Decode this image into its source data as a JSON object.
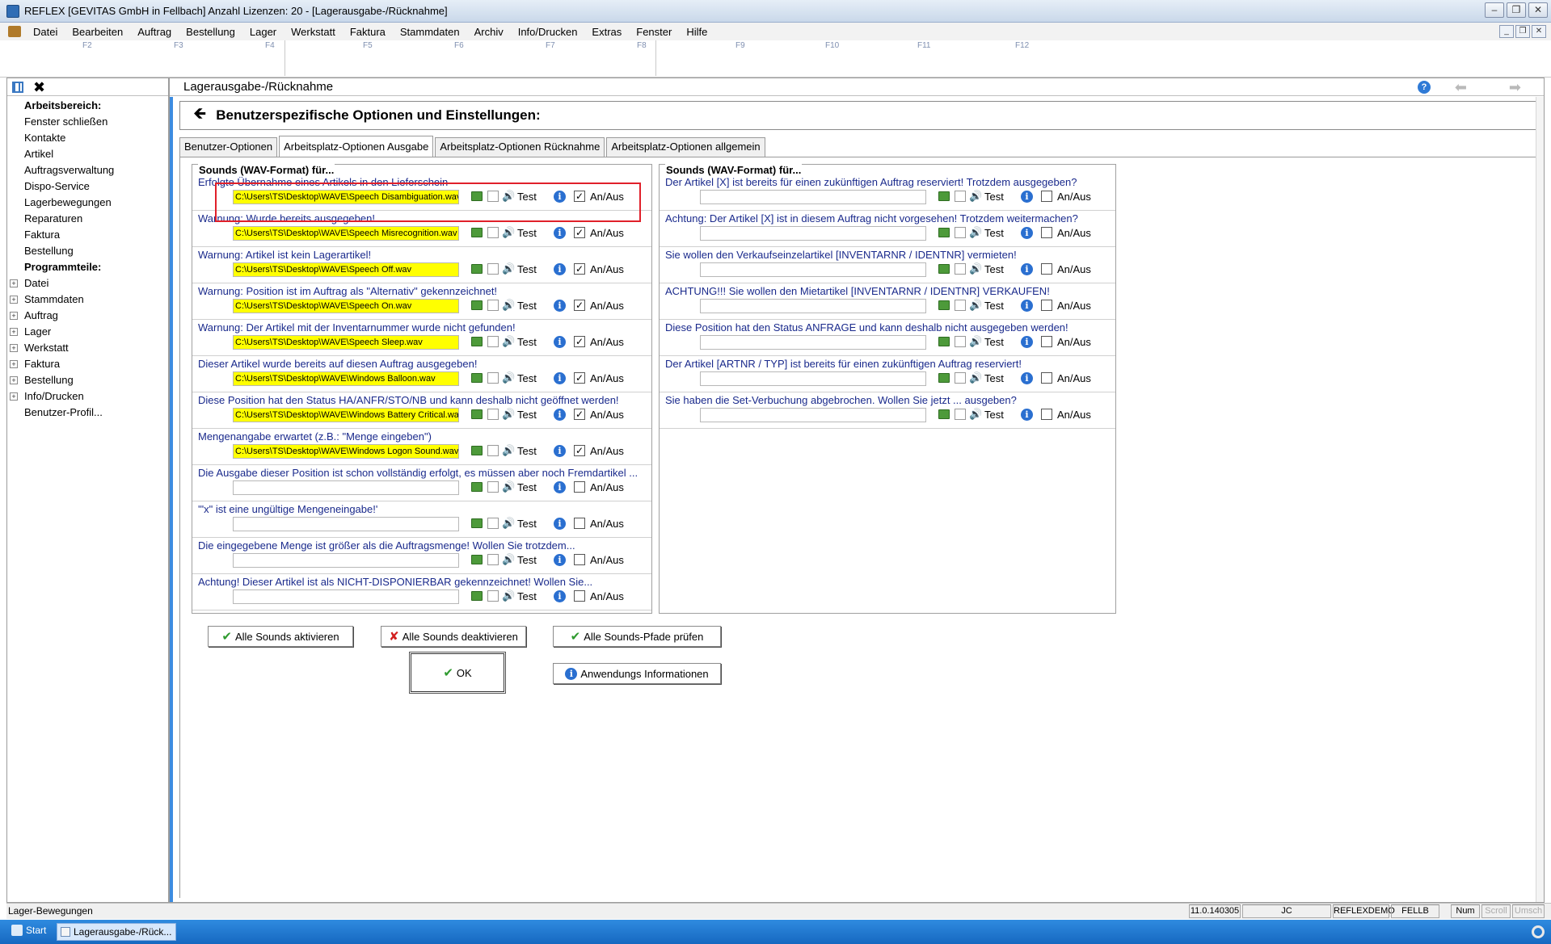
{
  "window": {
    "title": "REFLEX [GEVITAS GmbH in Fellbach] Anzahl Lizenzen: 20 - [Lagerausgabe-/Rücknahme]",
    "controls": {
      "minimize": "–",
      "restore": "❐",
      "close": "✕"
    }
  },
  "menubar": {
    "items": [
      "Datei",
      "Bearbeiten",
      "Auftrag",
      "Bestellung",
      "Lager",
      "Werkstatt",
      "Faktura",
      "Stammdaten",
      "Archiv",
      "Info/Drucken",
      "Extras",
      "Fenster",
      "Hilfe"
    ],
    "mdi_controls": {
      "minimize": "_",
      "restore": "❐",
      "close": "✕"
    }
  },
  "fkeys": [
    "F2",
    "F3",
    "F4",
    "F5",
    "F6",
    "F7",
    "F8",
    "F9",
    "F10",
    "F11",
    "F12"
  ],
  "sidebar": {
    "items": [
      {
        "label": "Arbeitsbereich:",
        "head": true
      },
      {
        "label": "Fenster schließen"
      },
      {
        "label": "Kontakte"
      },
      {
        "label": "Artikel"
      },
      {
        "label": "Auftragsverwaltung"
      },
      {
        "label": "Dispo-Service"
      },
      {
        "label": "Lagerbewegungen"
      },
      {
        "label": "Reparaturen"
      },
      {
        "label": "Faktura"
      },
      {
        "label": "Bestellung"
      },
      {
        "label": "Programmteile:",
        "head": true
      },
      {
        "label": "Datei",
        "expand": true
      },
      {
        "label": "Stammdaten",
        "expand": true
      },
      {
        "label": "Auftrag",
        "expand": true
      },
      {
        "label": "Lager",
        "expand": true
      },
      {
        "label": "Werkstatt",
        "expand": true
      },
      {
        "label": "Faktura",
        "expand": true
      },
      {
        "label": "Bestellung",
        "expand": true
      },
      {
        "label": "Info/Drucken",
        "expand": true
      },
      {
        "label": "Benutzer-Profil..."
      }
    ]
  },
  "main": {
    "title": "Lagerausgabe-/Rücknahme",
    "options_title": "Benutzerspezifische Optionen und Einstellungen:",
    "tabs": [
      {
        "label": "Benutzer-Optionen",
        "active": false
      },
      {
        "label": "Arbeitsplatz-Optionen Ausgabe",
        "active": true
      },
      {
        "label": "Arbeitsplatz-Optionen Rücknahme",
        "active": false
      },
      {
        "label": "Arbeitsplatz-Optionen allgemein",
        "active": false
      }
    ],
    "left_group": {
      "title": "Sounds (WAV-Format) für...",
      "rows": [
        {
          "label": "Erfolgte Übernahme eines Artikels in den Lieferschein",
          "path": "C:\\Users\\TS\\Desktop\\WAVE\\Speech Disambiguation.wav",
          "enabled": true
        },
        {
          "label": "Warnung: Wurde bereits ausgegeben!",
          "path": "C:\\Users\\TS\\Desktop\\WAVE\\Speech Misrecognition.wav",
          "enabled": true
        },
        {
          "label": "Warnung: Artikel ist kein Lagerartikel!",
          "path": "C:\\Users\\TS\\Desktop\\WAVE\\Speech Off.wav",
          "enabled": true
        },
        {
          "label": "Warnung: Position ist im Auftrag als \"Alternativ\" gekennzeichnet!",
          "path": "C:\\Users\\TS\\Desktop\\WAVE\\Speech On.wav",
          "enabled": true
        },
        {
          "label": "Warnung: Der Artikel mit der Inventarnummer wurde nicht gefunden!",
          "path": "C:\\Users\\TS\\Desktop\\WAVE\\Speech Sleep.wav",
          "enabled": true
        },
        {
          "label": "Dieser Artikel wurde bereits auf diesen Auftrag ausgegeben!",
          "path": "C:\\Users\\TS\\Desktop\\WAVE\\Windows Balloon.wav",
          "enabled": true
        },
        {
          "label": " Diese Position hat den Status HA/ANFR/STO/NB und kann deshalb nicht geöffnet werden!",
          "path": "C:\\Users\\TS\\Desktop\\WAVE\\Windows Battery Critical.wa",
          "enabled": true
        },
        {
          "label": "Mengenangabe erwartet (z.B.: \"Menge eingeben\")",
          "path": "C:\\Users\\TS\\Desktop\\WAVE\\Windows Logon Sound.wav",
          "enabled": true
        },
        {
          "label": "Die Ausgabe dieser Position ist schon vollständig erfolgt, es müssen aber noch Fremdartikel ...",
          "path": "",
          "enabled": false
        },
        {
          "label": "'\"x\" ist eine ungültige Mengeneingabe!'",
          "path": "",
          "enabled": false
        },
        {
          "label": "Die eingegebene Menge ist größer als die Auftragsmenge! Wollen Sie trotzdem...",
          "path": "",
          "enabled": false
        },
        {
          "label": "Achtung! Dieser Artikel ist als NICHT-DISPONIERBAR gekennzeichnet! Wollen Sie...",
          "path": "",
          "enabled": false
        }
      ]
    },
    "right_group": {
      "title": "Sounds (WAV-Format) für...",
      "rows": [
        {
          "label": "Der Artikel [X] ist bereits für einen zukünftigen Auftrag reserviert! Trotzdem ausgegeben?",
          "path": "",
          "enabled": false
        },
        {
          "label": "Achtung: Der Artikel [X] ist in diesem Auftrag nicht vorgesehen! Trotzdem weitermachen?",
          "path": "",
          "enabled": false
        },
        {
          "label": "Sie wollen den Verkaufseinzelartikel [INVENTARNR / IDENTNR] vermieten!",
          "path": "",
          "enabled": false
        },
        {
          "label": "ACHTUNG!!! Sie wollen den Mietartikel [INVENTARNR / IDENTNR] VERKAUFEN!",
          "path": "",
          "enabled": false
        },
        {
          "label": "Diese Position hat den Status ANFRAGE und kann deshalb nicht ausgegeben werden!",
          "path": "",
          "enabled": false
        },
        {
          "label": "Der Artikel [ARTNR / TYP] ist bereits für einen zukünftigen Auftrag reserviert!",
          "path": "",
          "enabled": false
        },
        {
          "label": " Sie haben die Set-Verbuchung abgebrochen. Wollen Sie jetzt ... ausgeben?",
          "path": "",
          "enabled": false
        }
      ]
    },
    "row_labels": {
      "test": "Test",
      "onoff": "An/Aus",
      "check": "✓"
    },
    "buttons": {
      "activate_all": "Alle Sounds aktivieren",
      "deactivate_all": "Alle Sounds deaktivieren",
      "check_paths": "Alle Sounds-Pfade prüfen",
      "ok": "OK",
      "app_info": "Anwendungs Informationen"
    }
  },
  "statusbar": {
    "left": "Lager-Bewegungen",
    "cells": [
      "11.0.140305",
      "JC",
      "REFLEXDEMO",
      "FELLB",
      "Num",
      "Scroll",
      "Umsch"
    ]
  },
  "taskbar": {
    "start": "Start",
    "task": "Lagerausgabe-/Rück..."
  }
}
